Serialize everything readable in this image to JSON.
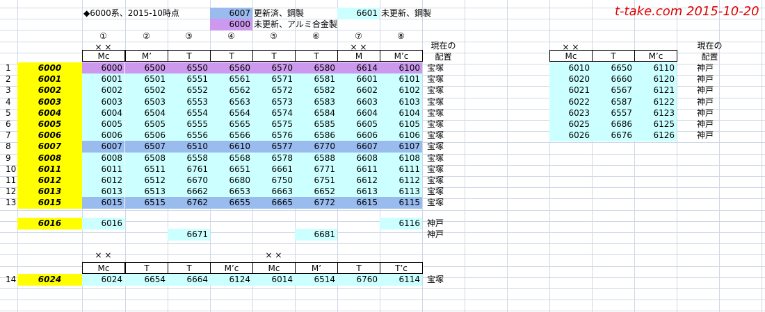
{
  "header": {
    "title": "◆6000系、2015-10時点",
    "legend": [
      {
        "code": "6007",
        "text": "更新済、鋼製",
        "color": "#99bbee"
      },
      {
        "code": "6601",
        "text": "未更新、鋼製",
        "color": "#ccffff"
      },
      {
        "code": "6000",
        "text": "未更新、アルミ合金製",
        "color": "#cc99ee"
      }
    ],
    "site": "t-take.com 2015-10-20"
  },
  "main": {
    "positions": [
      "①",
      "②",
      "③",
      "④",
      "⑤",
      "⑥",
      "⑦",
      "⑧"
    ],
    "xmarks": [
      "× ×",
      "× ×"
    ],
    "columns": [
      "Mc",
      "M’",
      "T",
      "T",
      "T",
      "T",
      "M",
      "M’c"
    ],
    "location_header": [
      "現在の",
      "配置"
    ],
    "rows": [
      {
        "no": "1",
        "set": "6000",
        "cars": [
          "6000",
          "6500",
          "6550",
          "6560",
          "6570",
          "6580",
          "6614",
          "6100"
        ],
        "loc": "宝塚",
        "style": "P"
      },
      {
        "no": "2",
        "set": "6001",
        "cars": [
          "6001",
          "6501",
          "6551",
          "6561",
          "6571",
          "6581",
          "6601",
          "6101"
        ],
        "loc": "宝塚",
        "style": "C"
      },
      {
        "no": "3",
        "set": "6002",
        "cars": [
          "6002",
          "6502",
          "6552",
          "6562",
          "6572",
          "6582",
          "6602",
          "6102"
        ],
        "loc": "宝塚",
        "style": "C"
      },
      {
        "no": "4",
        "set": "6003",
        "cars": [
          "6003",
          "6503",
          "6553",
          "6563",
          "6573",
          "6583",
          "6603",
          "6103"
        ],
        "loc": "宝塚",
        "style": "C"
      },
      {
        "no": "5",
        "set": "6004",
        "cars": [
          "6004",
          "6504",
          "6554",
          "6564",
          "6574",
          "6584",
          "6604",
          "6104"
        ],
        "loc": "宝塚",
        "style": "C"
      },
      {
        "no": "6",
        "set": "6005",
        "cars": [
          "6005",
          "6505",
          "6555",
          "6565",
          "6575",
          "6585",
          "6605",
          "6105"
        ],
        "loc": "宝塚",
        "style": "C"
      },
      {
        "no": "7",
        "set": "6006",
        "cars": [
          "6006",
          "6506",
          "6556",
          "6566",
          "6576",
          "6586",
          "6606",
          "6106"
        ],
        "loc": "宝塚",
        "style": "C"
      },
      {
        "no": "8",
        "set": "6007",
        "cars": [
          "6007",
          "6507",
          "6510",
          "6610",
          "6577",
          "6770",
          "6607",
          "6107"
        ],
        "loc": "宝塚",
        "style": "B"
      },
      {
        "no": "9",
        "set": "6008",
        "cars": [
          "6008",
          "6508",
          "6558",
          "6568",
          "6578",
          "6588",
          "6608",
          "6108"
        ],
        "loc": "宝塚",
        "style": "C"
      },
      {
        "no": "10",
        "set": "6011",
        "cars": [
          "6011",
          "6511",
          "6761",
          "6651",
          "6661",
          "6771",
          "6611",
          "6111"
        ],
        "loc": "宝塚",
        "style": "C"
      },
      {
        "no": "11",
        "set": "6012",
        "cars": [
          "6012",
          "6512",
          "6670",
          "6680",
          "6750",
          "6751",
          "6612",
          "6112"
        ],
        "loc": "宝塚",
        "style": "C"
      },
      {
        "no": "12",
        "set": "6013",
        "cars": [
          "6013",
          "6513",
          "6662",
          "6653",
          "6663",
          "6652",
          "6613",
          "6113"
        ],
        "loc": "宝塚",
        "style": "C"
      },
      {
        "no": "13",
        "set": "6015",
        "cars": [
          "6015",
          "6515",
          "6762",
          "6655",
          "6665",
          "6772",
          "6615",
          "6115"
        ],
        "loc": "宝塚",
        "style": "B"
      }
    ],
    "extra1": {
      "set": "6016",
      "car1": "6016",
      "car8": "6116",
      "loc": "神戸"
    },
    "extra2": {
      "car3": "6671",
      "car6": "6681",
      "loc": "神戸"
    }
  },
  "bottom": {
    "xmarks": [
      "× ×",
      "× ×"
    ],
    "columns": [
      "Mc",
      "T",
      "T",
      "M’c",
      "Mc",
      "M’",
      "T",
      "T’c"
    ],
    "row": {
      "no": "14",
      "set": "6024",
      "cars": [
        "6024",
        "6654",
        "6664",
        "6124",
        "6014",
        "6514",
        "6760",
        "6114"
      ],
      "loc": "宝塚"
    }
  },
  "right": {
    "xmarks": "× ×",
    "columns": [
      "Mc",
      "T",
      "M’c"
    ],
    "location_header": [
      "現在の",
      "配置"
    ],
    "rows": [
      {
        "cars": [
          "6010",
          "6650",
          "6110"
        ],
        "loc": "神戸"
      },
      {
        "cars": [
          "6020",
          "6660",
          "6120"
        ],
        "loc": "神戸"
      },
      {
        "cars": [
          "6021",
          "6567",
          "6121"
        ],
        "loc": "神戸"
      },
      {
        "cars": [
          "6022",
          "6587",
          "6122"
        ],
        "loc": "神戸"
      },
      {
        "cars": [
          "6023",
          "6557",
          "6123"
        ],
        "loc": "神戸"
      },
      {
        "cars": [
          "6025",
          "6686",
          "6125"
        ],
        "loc": "神戸"
      },
      {
        "cars": [
          "6026",
          "6676",
          "6126"
        ],
        "loc": "神戸"
      }
    ]
  }
}
